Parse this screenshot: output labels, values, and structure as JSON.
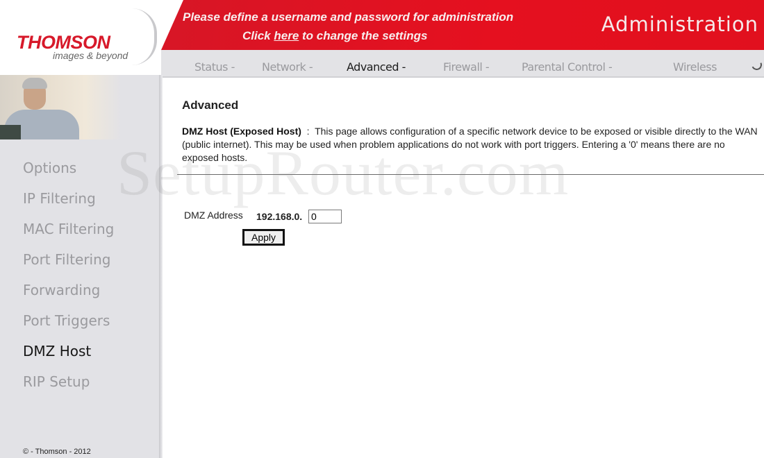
{
  "brand": {
    "name": "THOMSON",
    "tagline": "images & beyond"
  },
  "banner": {
    "message_line1": "Please define a username and password for administration",
    "message_line2_prefix": "Click ",
    "message_line2_link": "here",
    "message_line2_suffix": " to change the settings",
    "section_title": "Administration",
    "accent_color": "#e3101f"
  },
  "topnav": {
    "items": [
      {
        "label": "Status -",
        "active": false
      },
      {
        "label": "Network -",
        "active": false
      },
      {
        "label": "Advanced -",
        "active": true
      },
      {
        "label": "Firewall -",
        "active": false
      },
      {
        "label": "Parental Control -",
        "active": false
      },
      {
        "label": "Wireless",
        "active": false
      }
    ],
    "status_icon": "loading-spinner-icon"
  },
  "sidebar": {
    "items": [
      {
        "label": "Options",
        "active": false
      },
      {
        "label": "IP Filtering",
        "active": false
      },
      {
        "label": "MAC Filtering",
        "active": false
      },
      {
        "label": "Port Filtering",
        "active": false
      },
      {
        "label": "Forwarding",
        "active": false
      },
      {
        "label": "Port Triggers",
        "active": false
      },
      {
        "label": "DMZ Host",
        "active": true
      },
      {
        "label": "RIP Setup",
        "active": false
      }
    ],
    "copyright": "© - Thomson - 2012"
  },
  "watermark": "SetupRouter.com",
  "main": {
    "heading": "Advanced",
    "description_title": "DMZ Host (Exposed Host)",
    "description_sep": "  :  ",
    "description_body": "This page allows configuration of a specific network device to be exposed or visible directly to the WAN (public internet). This may be used when problem applications do not work with port triggers. Entering a '0' means there are no exposed hosts.",
    "dmz_label": "DMZ Address",
    "dmz_prefix": "192.168.0.",
    "dmz_value": "0",
    "apply_label": "Apply"
  }
}
